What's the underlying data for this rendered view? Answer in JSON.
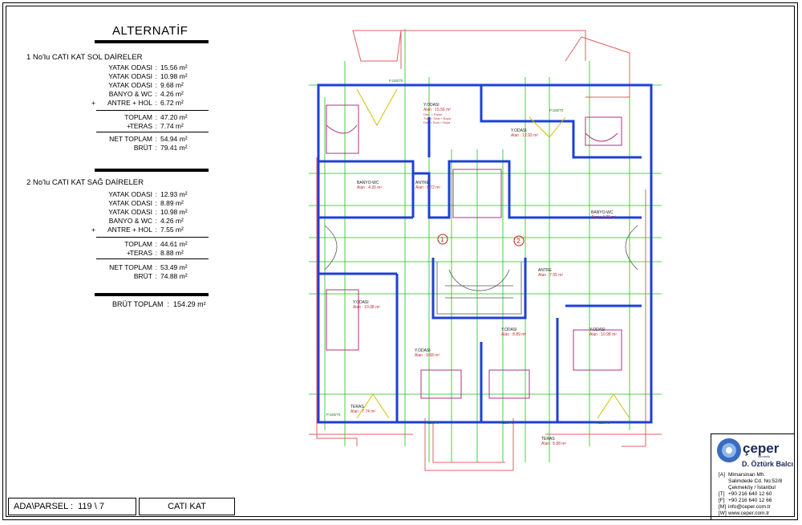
{
  "title": "ALTERNATİF",
  "section1": {
    "title": "1  No'lu CATI KAT SOL DAİRELER",
    "rows": [
      {
        "label": "YATAK ODASI",
        "value": "15.56 m²",
        "plus": ""
      },
      {
        "label": "YATAK ODASI",
        "value": "10.98 m²",
        "plus": ""
      },
      {
        "label": "YATAK ODASI",
        "value": "9.68 m²",
        "plus": ""
      },
      {
        "label": "BANYO & WC",
        "value": "4.26 m²",
        "plus": ""
      },
      {
        "label": "ANTRE + HOL",
        "value": "6.72 m²",
        "plus": "+"
      }
    ],
    "toplam": {
      "label": "TOPLAM",
      "value": "47.20 m²"
    },
    "teras": {
      "label": "TERAS",
      "value": "7.74 m²",
      "plus": "+"
    },
    "net": {
      "label": "NET TOPLAM",
      "value": "54.94 m²"
    },
    "brut": {
      "label": "BRÜT",
      "value": "79.41 m²"
    }
  },
  "section2": {
    "title": "2  No'lu CATI KAT SAĞ DAİRELER",
    "rows": [
      {
        "label": "YATAK ODASI",
        "value": "12.93 m²",
        "plus": ""
      },
      {
        "label": "YATAK ODASI",
        "value": "8.89 m²",
        "plus": ""
      },
      {
        "label": "YATAK ODASI",
        "value": "10.98 m²",
        "plus": ""
      },
      {
        "label": "BANYO & WC",
        "value": "4.26 m²",
        "plus": ""
      },
      {
        "label": "ANTRE + HOL",
        "value": "7.55 m²",
        "plus": "+"
      }
    ],
    "toplam": {
      "label": "TOPLAM",
      "value": "44.61 m²"
    },
    "teras": {
      "label": "TERAS",
      "value": "8.88 m²",
      "plus": "+"
    },
    "net": {
      "label": "NET TOPLAM",
      "value": "53.49 m²"
    },
    "brut": {
      "label": "BRÜT",
      "value": "74.88 m²"
    }
  },
  "brut_toplam": {
    "label": "BRÜT TOPLAM",
    "value": "154.29 m²"
  },
  "footer": {
    "ada_label": "ADA\\PARSEL :",
    "ada_value": "119 \\ 7",
    "floor": "CATI KAT"
  },
  "logo": {
    "name": "çeper",
    "sub": "D. Öztürk Balcı",
    "arch": "Mimarlık"
  },
  "contact": [
    {
      "key": "[A]",
      "text": "Mimarsinan Mh."
    },
    {
      "key": "",
      "text": "Salimdede Cd. No:52/8"
    },
    {
      "key": "",
      "text": "Çekmeköy / İstanbul"
    },
    {
      "key": "[T]",
      "text": "+90 216 640 12 60"
    },
    {
      "key": "[F]",
      "text": "+90 216 640 12 66"
    },
    {
      "key": "[M]",
      "text": "info@ceper.com.tr"
    },
    {
      "key": "[W]",
      "text": "www.ceper.com.tr"
    }
  ],
  "plan": {
    "rooms": [
      {
        "name": "Y.ODASI",
        "area": "Alan : 15.56 m²"
      },
      {
        "name": "Y.ODASI",
        "area": "Alan : 12.93 m²"
      },
      {
        "name": "BANYO-WC",
        "area": "Alan : 4.26 m²"
      },
      {
        "name": "ANTRE",
        "area": "Alan : 6.72 m²"
      },
      {
        "name": "BANYO-WC",
        "area": "Alan : 4.26 m²"
      },
      {
        "name": "ANTRE",
        "area": "Alan : 7.55 m²"
      },
      {
        "name": "Y.ODASI",
        "area": "Alan : 10.98 m²"
      },
      {
        "name": "Y.ODASI",
        "area": "Alan : 9.68 m²"
      },
      {
        "name": "Y.ODASI",
        "area": "Alan : 8.89 m²"
      },
      {
        "name": "Y.ODASI",
        "area": "Alan : 10.98 m²"
      },
      {
        "name": "TERAS",
        "area": "Alan : 7.74 m²"
      },
      {
        "name": "TERAS",
        "area": "Alan : 8.88 m²"
      }
    ],
    "finish": [
      "Döş. = Parke",
      "Tvn. = Sıva + Boya",
      "Dvr. = Sıva + Boya"
    ],
    "markers": [
      "1",
      "2"
    ],
    "windows": [
      "P.150/70",
      "P.150/70",
      "P.150/70",
      "P.150/70",
      "P.150/70",
      "P.150/70"
    ],
    "colors": {
      "wall": "#1f3fd6",
      "grid": "#18c418",
      "outline": "#e06060",
      "furniture": "#b03080",
      "door": "#d0c000"
    }
  }
}
